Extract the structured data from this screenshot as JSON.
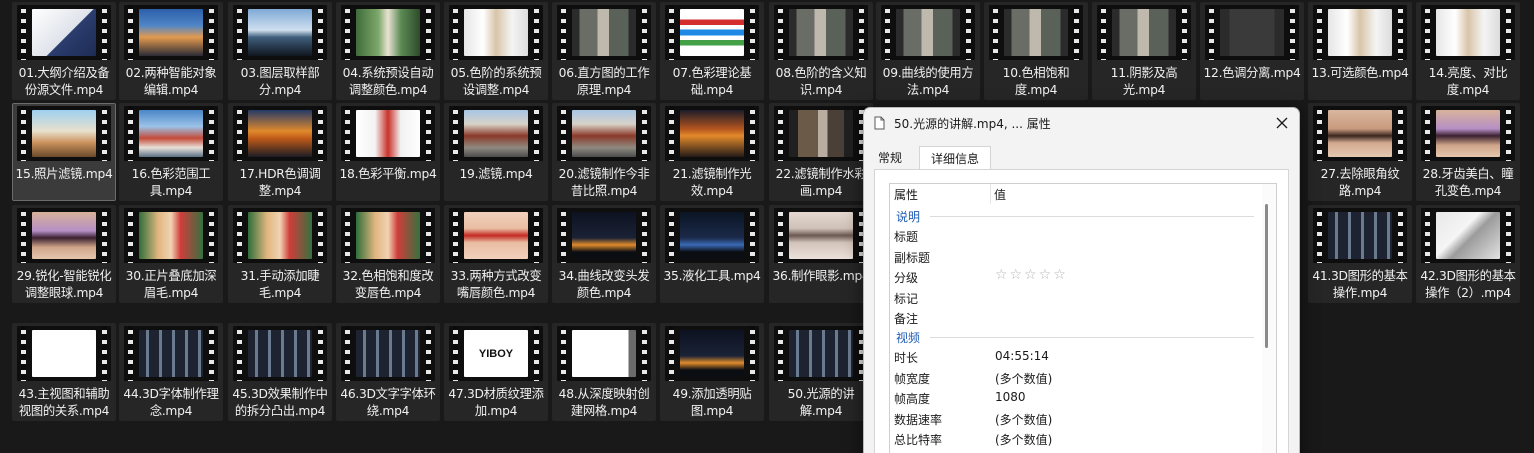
{
  "videos": [
    {
      "label": "01.大纲介绍及备份源文件.mp4",
      "thumb": "ppt"
    },
    {
      "label": "02.两种智能对象编辑.mp4",
      "thumb": "sunset"
    },
    {
      "label": "03.图层取样部分.mp4",
      "thumb": "sky"
    },
    {
      "label": "04.系统预设自动调整颜色.mp4",
      "thumb": "portrait-green"
    },
    {
      "label": "05.色阶的系统预设调整.mp4",
      "thumb": "portrait-white"
    },
    {
      "label": "06.直方图的工作原理.mp4",
      "thumb": "photoshop-street"
    },
    {
      "label": "07.色彩理论基础.mp4",
      "thumb": "color-theory"
    },
    {
      "label": "08.色阶的含义知识.mp4",
      "thumb": "photoshop-street"
    },
    {
      "label": "09.曲线的使用方法.mp4",
      "thumb": "photoshop-street"
    },
    {
      "label": "10.色相饱和度.mp4",
      "thumb": "photoshop-street"
    },
    {
      "label": "11.阴影及高光.mp4",
      "thumb": "photoshop-street"
    },
    {
      "label": "12.色调分离.mp4",
      "thumb": "photoshop-dark"
    },
    {
      "label": "13.可选颜色.mp4",
      "thumb": "portrait-white"
    },
    {
      "label": "14.亮度、对比度.mp4",
      "thumb": "portrait-white"
    },
    {
      "label": "15.照片滤镜.mp4",
      "thumb": "beach"
    },
    {
      "label": "16.色彩范围工具.mp4",
      "thumb": "city"
    },
    {
      "label": "17.HDR色调调整.mp4",
      "thumb": "hdr"
    },
    {
      "label": "18.色彩平衡.mp4",
      "thumb": "portrait-red"
    },
    {
      "label": "19.滤镜.mp4",
      "thumb": "street"
    },
    {
      "label": "20.滤镜制作今非昔比照.mp4",
      "thumb": "street"
    },
    {
      "label": "21.滤镜制作光效.mp4",
      "thumb": "sunset-dark"
    },
    {
      "label": "22.滤镜制作水彩画.mp4",
      "thumb": "street-dark"
    },
    {
      "label": "27.去除眼角纹路.mp4",
      "thumb": "eye-skin"
    },
    {
      "label": "28.牙齿美白、瞳孔变色.mp4",
      "thumb": "eye-purple"
    },
    {
      "label": "29.锐化-智能锐化调整眼球.mp4",
      "thumb": "eye-purple"
    },
    {
      "label": "30.正片叠底加深眉毛.mp4",
      "thumb": "portrait-flowers"
    },
    {
      "label": "31.手动添加睫毛.mp4",
      "thumb": "portrait-flowers"
    },
    {
      "label": "32.色相饱和度改变唇色.mp4",
      "thumb": "portrait-flowers"
    },
    {
      "label": "33.两种方式改变嘴唇颜色.mp4",
      "thumb": "lips"
    },
    {
      "label": "34.曲线改变头发颜色.mp4",
      "thumb": "night"
    },
    {
      "label": "35.液化工具.mp4",
      "thumb": "night-blue"
    },
    {
      "label": "36.制作眼影.mp4",
      "thumb": "eye-gray"
    },
    {
      "label": "41.3D图形的基本操作.mp4",
      "thumb": "grid-dark"
    },
    {
      "label": "42.3D图形的基本操作（2）.mp4",
      "thumb": "cube"
    },
    {
      "label": "43.主视图和辅助视图的关系.mp4",
      "thumb": "white"
    },
    {
      "label": "44.3D字体制作理念.mp4",
      "thumb": "grid-dark"
    },
    {
      "label": "45.3D效果制作中的拆分凸出.mp4",
      "thumb": "grid-dark"
    },
    {
      "label": "46.3D文字字体环绕.mp4",
      "thumb": "grid-dark"
    },
    {
      "label": "47.3D材质纹理添加.mp4",
      "thumb": "yiboy",
      "thumb_text": "YIBOY"
    },
    {
      "label": "48.从深度映射创建网格.mp4",
      "thumb": "white-gray"
    },
    {
      "label": "49.添加透明贴图.mp4",
      "thumb": "night"
    },
    {
      "label": "50.光源的讲解.mp4",
      "thumb": "grid-dark"
    }
  ],
  "dialog": {
    "title": "50.光源的讲解.mp4, ... 属性",
    "tabs": [
      "常规",
      "详细信息"
    ],
    "active_tab": "详细信息",
    "columns": [
      "属性",
      "值"
    ],
    "sections": [
      {
        "name": "说明",
        "rows": [
          {
            "key": "标题",
            "value": ""
          },
          {
            "key": "副标题",
            "value": ""
          },
          {
            "key": "分级",
            "value": "☆☆☆☆☆",
            "rating": 0
          },
          {
            "key": "标记",
            "value": ""
          },
          {
            "key": "备注",
            "value": ""
          }
        ]
      },
      {
        "name": "视频",
        "rows": [
          {
            "key": "时长",
            "value": "04:55:14"
          },
          {
            "key": "帧宽度",
            "value": "(多个数值)"
          },
          {
            "key": "帧高度",
            "value": "1080"
          },
          {
            "key": "数据速率",
            "value": "(多个数值)"
          },
          {
            "key": "总比特率",
            "value": "(多个数值)"
          }
        ]
      }
    ]
  },
  "colors": {
    "background": "#191919",
    "tile": "#262626",
    "tile_selected": "#3b3b3b",
    "dialog_bg": "#f3f3f3",
    "section_blue": "#1f5cb5"
  },
  "selected_index": 14
}
